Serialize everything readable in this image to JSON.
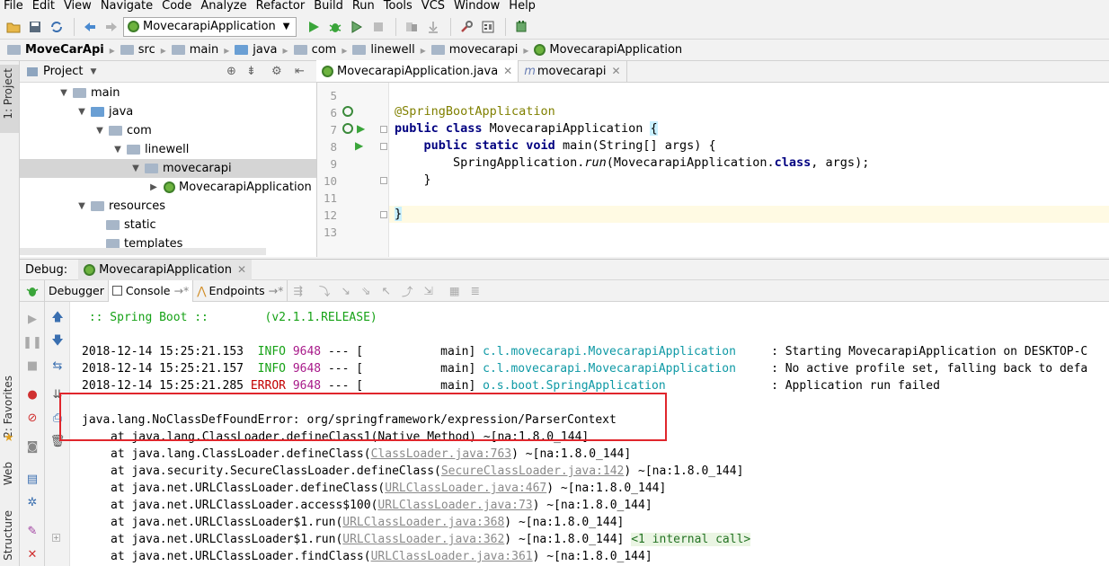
{
  "menu": [
    "File",
    "Edit",
    "View",
    "Navigate",
    "Code",
    "Analyze",
    "Refactor",
    "Build",
    "Run",
    "Tools",
    "VCS",
    "Window",
    "Help"
  ],
  "toolbar": {
    "run_config": "MovecarapiApplication",
    "icons": [
      "open-icon",
      "save-icon",
      "sync-icon",
      "back-icon",
      "forward-icon",
      "run-icon",
      "debug-icon",
      "coverage-icon",
      "stop-icon",
      "vcs-icon",
      "settings-icon",
      "structure-icon",
      "sdk-icon"
    ]
  },
  "breadcrumb": [
    "MoveCarApi",
    "src",
    "main",
    "java",
    "com",
    "linewell",
    "movecarapi",
    "MovecarapiApplication"
  ],
  "left_stripe": {
    "project": "1: Project",
    "favorites": "2: Favorites",
    "web": "Web",
    "structure": "Structure"
  },
  "project": {
    "title": "Project",
    "tree": [
      {
        "label": "main",
        "depth": 0,
        "expanded": true,
        "type": "folder"
      },
      {
        "label": "java",
        "depth": 1,
        "expanded": true,
        "type": "source"
      },
      {
        "label": "com",
        "depth": 2,
        "expanded": true,
        "type": "package"
      },
      {
        "label": "linewell",
        "depth": 3,
        "expanded": true,
        "type": "package"
      },
      {
        "label": "movecarapi",
        "depth": 4,
        "expanded": true,
        "type": "package",
        "selected": true
      },
      {
        "label": "MovecarapiApplication",
        "depth": 5,
        "expanded": false,
        "type": "class"
      },
      {
        "label": "resources",
        "depth": 1,
        "expanded": true,
        "type": "folder"
      },
      {
        "label": "static",
        "depth": 2,
        "expanded": false,
        "type": "folder"
      },
      {
        "label": "templates",
        "depth": 2,
        "expanded": false,
        "type": "folder"
      }
    ]
  },
  "editor": {
    "tabs": [
      {
        "label": "MovecarapiApplication.java",
        "active": true
      },
      {
        "label": "movecarapi",
        "active": false
      }
    ],
    "lines": [
      {
        "n": "5",
        "text": ""
      },
      {
        "n": "6",
        "text": "@SpringBootApplication"
      },
      {
        "n": "7",
        "text": "public class MovecarapiApplication {"
      },
      {
        "n": "8",
        "text": "    public static void main(String[] args) {"
      },
      {
        "n": "9",
        "text": "        SpringApplication.run(MovecarapiApplication.class, args);"
      },
      {
        "n": "10",
        "text": "    }"
      },
      {
        "n": "11",
        "text": ""
      },
      {
        "n": "12",
        "text": "}"
      },
      {
        "n": "13",
        "text": ""
      }
    ]
  },
  "debug": {
    "label": "Debug:",
    "session": "MovecarapiApplication",
    "tabs": [
      "Debugger",
      "Console",
      "Endpoints"
    ],
    "console": {
      "banner": " :: Spring Boot ::        (v2.1.1.RELEASE)",
      "logs": [
        {
          "ts": "2018-12-14 15:25:21.153",
          "level": "INFO",
          "pid": "9648",
          "sep": " --- [",
          "thread": "           main]",
          "logger": "c.l.movecarapi.MovecarapiApplication",
          "msg": ": Starting MovecarapiApplication on DESKTOP-C"
        },
        {
          "ts": "2018-12-14 15:25:21.157",
          "level": "INFO",
          "pid": "9648",
          "sep": " --- [",
          "thread": "           main]",
          "logger": "c.l.movecarapi.MovecarapiApplication",
          "msg": ": No active profile set, falling back to defa"
        },
        {
          "ts": "2018-12-14 15:25:21.285",
          "level": "ERROR",
          "pid": "9648",
          "sep": " --- [",
          "thread": "           main]",
          "logger": "o.s.boot.SpringApplication",
          "msg": ": Application run failed"
        }
      ],
      "error": "java.lang.NoClassDefFoundError: org/springframework/expression/ParserContext",
      "stack": [
        {
          "pre": "at java.lang.ClassLoader.defineClass1(",
          "src": "Native Method",
          "link": false,
          "post": ") ~[na:1.8.0_144]"
        },
        {
          "pre": "at java.lang.ClassLoader.defineClass(",
          "src": "ClassLoader.java:763",
          "link": true,
          "post": ") ~[na:1.8.0_144]"
        },
        {
          "pre": "at java.security.SecureClassLoader.defineClass(",
          "src": "SecureClassLoader.java:142",
          "link": true,
          "post": ") ~[na:1.8.0_144]"
        },
        {
          "pre": "at java.net.URLClassLoader.defineClass(",
          "src": "URLClassLoader.java:467",
          "link": true,
          "post": ") ~[na:1.8.0_144]"
        },
        {
          "pre": "at java.net.URLClassLoader.access$100(",
          "src": "URLClassLoader.java:73",
          "link": true,
          "post": ") ~[na:1.8.0_144]"
        },
        {
          "pre": "at java.net.URLClassLoader$1.run(",
          "src": "URLClassLoader.java:368",
          "link": true,
          "post": ") ~[na:1.8.0_144]"
        },
        {
          "pre": "at java.net.URLClassLoader$1.run(",
          "src": "URLClassLoader.java:362",
          "link": true,
          "post": ") ~[na:1.8.0_144] ",
          "extra": "<1 internal call>"
        },
        {
          "pre": "at java.net.URLClassLoader.findClass(",
          "src": "URLClassLoader.java:361",
          "link": true,
          "post": ") ~[na:1.8.0_144]"
        }
      ]
    }
  }
}
